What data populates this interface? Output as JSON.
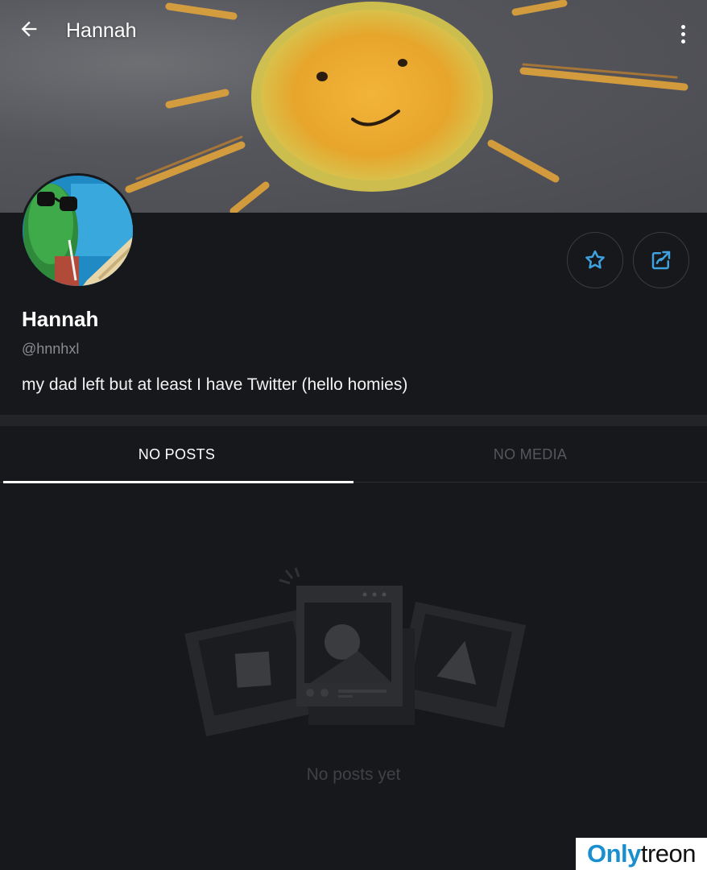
{
  "header": {
    "title": "Hannah",
    "back_icon": "arrow-left-icon",
    "more_icon": "more-vertical-icon"
  },
  "profile": {
    "name": "Hannah",
    "handle": "@hnnhxl",
    "bio": "my dad left but at least I have Twitter (hello homies)"
  },
  "actions": {
    "favorite_icon": "star-icon",
    "share_icon": "share-icon"
  },
  "tabs": [
    {
      "label": "NO POSTS",
      "active": true
    },
    {
      "label": "NO MEDIA",
      "active": false
    }
  ],
  "empty_state": {
    "message": "No posts yet"
  },
  "watermark": {
    "part1": "Only",
    "part2": "treon"
  },
  "colors": {
    "background": "#17181b",
    "accent": "#3ea2e0",
    "muted": "#8a8c91"
  }
}
